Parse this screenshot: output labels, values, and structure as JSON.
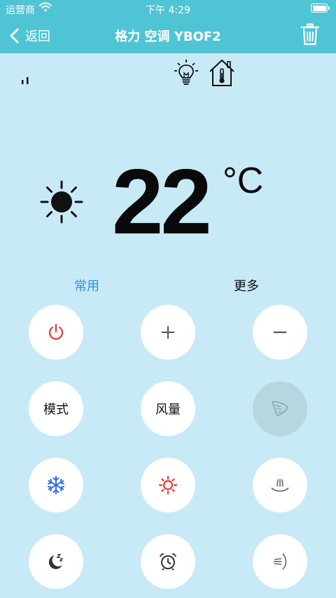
{
  "status": {
    "carrier": "运营商",
    "time": "下午 4:29"
  },
  "nav": {
    "back_label": "返回",
    "title": "格力 空调 YBOF2"
  },
  "display": {
    "temperature": "22",
    "unit": "°C"
  },
  "tabs": {
    "common": "常用",
    "more": "更多"
  },
  "buttons": {
    "mode": "模式",
    "fan": "风量"
  },
  "colors": {
    "header": "#4fc4d4",
    "background": "#c8eaf7",
    "power": "#e53935",
    "cool": "#2f6fe6",
    "heat": "#e53935",
    "tab_active": "#2f8fe6"
  }
}
